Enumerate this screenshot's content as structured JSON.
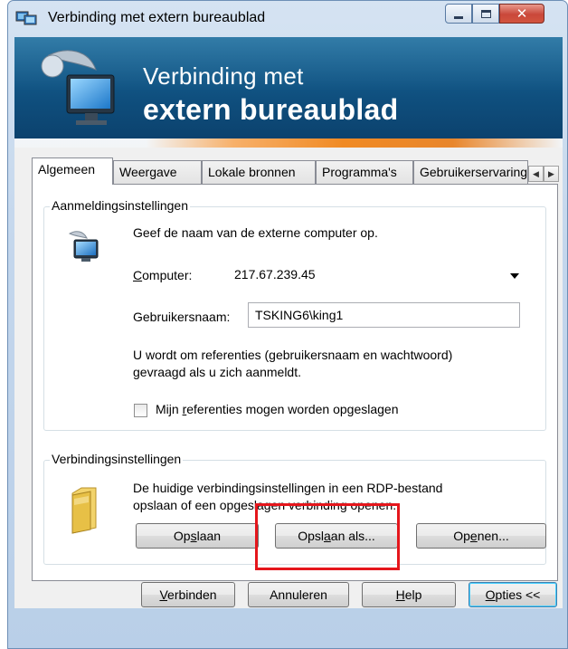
{
  "window": {
    "title": "Verbinding met extern bureaublad"
  },
  "banner": {
    "line1": "Verbinding met",
    "line2": "extern bureaublad"
  },
  "tabs": [
    {
      "label": "Algemeen",
      "active": true
    },
    {
      "label": "Weergave",
      "active": false
    },
    {
      "label": "Lokale bronnen",
      "active": false
    },
    {
      "label": "Programma's",
      "active": false
    },
    {
      "label": "Gebruikerservaring",
      "active": false
    }
  ],
  "login_settings": {
    "legend": "Aanmeldingsinstellingen",
    "description": "Geef de naam van de externe computer op.",
    "computer_label": "Computer:",
    "computer_value": "217.67.239.45",
    "username_label": "Gebruikersnaam:",
    "username_value": "TSKING6\\king1",
    "info_line1": "U wordt om referenties (gebruikersnaam en wachtwoord)",
    "info_line2": "gevraagd als u zich aanmeldt.",
    "save_credentials_label": "Mijn referenties mogen worden opgeslagen",
    "save_credentials_checked": false
  },
  "connection_settings": {
    "legend": "Verbindingsinstellingen",
    "description_line1": "De huidige verbindingsinstellingen in een RDP-bestand",
    "description_line2": "opslaan of een opgeslagen verbinding openen.",
    "save_button": "Opslaan",
    "save_as_button": "Opslaan als...",
    "open_button": "Openen..."
  },
  "footer": {
    "connect_button": "Verbinden",
    "cancel_button": "Annuleren",
    "help_button": "Help",
    "options_button": "Opties <<"
  },
  "colors": {
    "banner": "#0f4f7e",
    "highlight": "#e5161c",
    "accent_orange": "#f08a24"
  },
  "icons": {
    "app": "remote-desktop-icon",
    "computer": "computer-monitor-icon",
    "folder": "folder-icon"
  }
}
